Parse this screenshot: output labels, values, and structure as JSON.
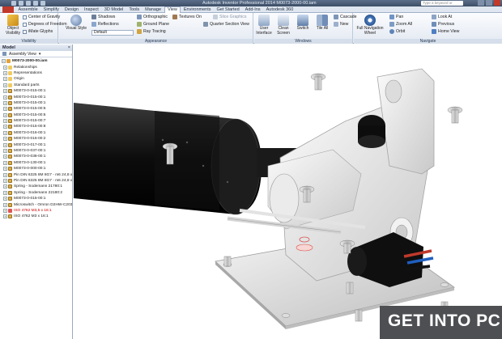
{
  "titlebar": {
    "app_title": "Autodesk Inventor Professional 2014   M0073-2000-00.iam",
    "search_placeholder": "Type a keyword or phrase"
  },
  "tabs": [
    "Assemble",
    "Simplify",
    "Design",
    "Inspect",
    "3D Model",
    "Tools",
    "Manage",
    "View",
    "Environments",
    "Get Started",
    "Add-Ins",
    "Autodesk 360"
  ],
  "active_tab": "View",
  "ribbon": {
    "visibility": {
      "label": "Visibility",
      "object_visibility": "Object Visibility",
      "center_of_gravity": "Center of Gravity",
      "degrees_of_freedom": "Degrees of Freedom",
      "ilogic_glyphs": "iMate Glyphs"
    },
    "appearance": {
      "label": "Appearance",
      "visual_style": "Visual Style",
      "shadows": "Shadows",
      "reflections": "Reflections",
      "style_dropdown": "Default",
      "orthographic": "Orthographic",
      "ground_plane": "Ground Plane",
      "ray_tracing": "Ray Tracing",
      "textures_on": "Textures On",
      "slice_graphics": "Slice Graphics",
      "quarter_section_view": "Quarter Section View"
    },
    "windows": {
      "label": "Windows",
      "user_interface": "User Interface",
      "clean_screen": "Clean Screen",
      "switch": "Switch",
      "tile_all": "Tile All",
      "cascade": "Cascade",
      "new": "New"
    },
    "navigate": {
      "label": "Navigate",
      "full_navigation_wheel": "Full Navigation Wheel",
      "pan": "Pan",
      "zoom_all": "Zoom All",
      "orbit": "Orbit",
      "look_at": "Look At",
      "previous": "Previous",
      "home_view": "Home View"
    }
  },
  "browser": {
    "title": "Model",
    "view_mode": "Assembly View",
    "tree": [
      {
        "label": "M0073-2000-00.iam",
        "type": "asm",
        "top": true
      },
      {
        "label": "Relationships",
        "type": "folder"
      },
      {
        "label": "Representations",
        "type": "folder"
      },
      {
        "label": "Origin",
        "type": "folder"
      },
      {
        "label": "Standard parts",
        "type": "folder"
      },
      {
        "label": "M0073-0-015-00:1",
        "type": "part"
      },
      {
        "label": "M0073-0-015-00:1",
        "type": "part"
      },
      {
        "label": "M0073-0-015-00:1",
        "type": "part"
      },
      {
        "label": "M0073-0-015-00:5",
        "type": "part"
      },
      {
        "label": "M0073-0-015-00:6",
        "type": "part"
      },
      {
        "label": "M0073-0-015-00:7",
        "type": "part"
      },
      {
        "label": "M0073-0-015-00:8",
        "type": "part"
      },
      {
        "label": "M0073-0-016-00:1",
        "type": "part"
      },
      {
        "label": "M0073-0-016-00:2",
        "type": "part"
      },
      {
        "label": "M0073-0-017-00:1",
        "type": "part"
      },
      {
        "label": "M0073-0-037-00:1",
        "type": "part"
      },
      {
        "label": "M0073-0-038-00:1",
        "type": "part"
      },
      {
        "label": "M0073-0-130-00:1",
        "type": "part"
      },
      {
        "label": "M0073-0-000-00:1",
        "type": "part"
      },
      {
        "label": "Pin DIN 6325 8M 8G7 - m6 24,8 x 24(...",
        "type": "part"
      },
      {
        "label": "Pin DIN 6325 8M 8G7 - m6 24,8 x 24(...",
        "type": "part"
      },
      {
        "label": "Spring - Sodemann 21780:1",
        "type": "part"
      },
      {
        "label": "Spring - Sodemann 22180:2",
        "type": "part"
      },
      {
        "label": "M0073-0-015-00:1",
        "type": "part"
      },
      {
        "label": "Microswitch - Omron D2HW-C203M:1",
        "type": "part"
      },
      {
        "label": "ISO 4762 M3,5 x 16:1",
        "type": "red",
        "sel": true
      },
      {
        "label": "ISO 4762 M3 x 16:1",
        "type": "part"
      }
    ]
  },
  "watermark": {
    "text": "GET INTO PC"
  },
  "colors": {
    "app_menu": "#c0392b",
    "ribbon_bg": "#e3e9f2",
    "browser_header": "#cdd8e6",
    "watermark_bg": "#4d4f53"
  }
}
